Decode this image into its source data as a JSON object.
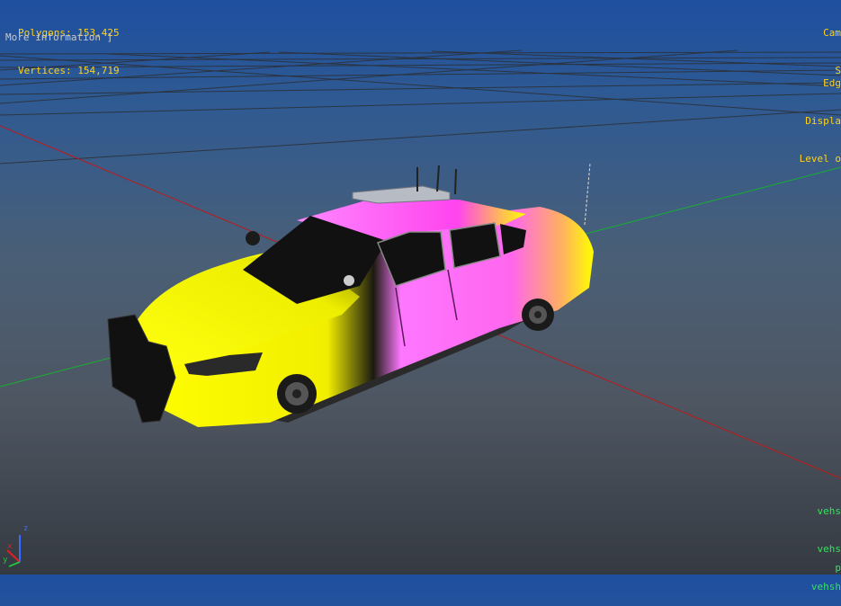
{
  "stats": {
    "polygons": "Polygons: 153,425",
    "vertices": "Vertices: 154,719"
  },
  "more_info": "More information ]",
  "right_top": [
    "Cam",
    "S"
  ],
  "right_mid": [
    "Edg",
    "Displa",
    "Level o"
  ],
  "right_bot": [
    "vehs",
    "vehs",
    "vehsh"
  ],
  "right_last": "p",
  "gizmo": {
    "z": "z",
    "y": "y",
    "x": "x"
  },
  "colors": {
    "hud_yellow": "#ffd21a",
    "hud_green": "#37e060",
    "car_yellow": "#ffff00",
    "car_pink": "#ff66ff",
    "axis_red": "#c01818",
    "axis_green": "#18b030"
  }
}
